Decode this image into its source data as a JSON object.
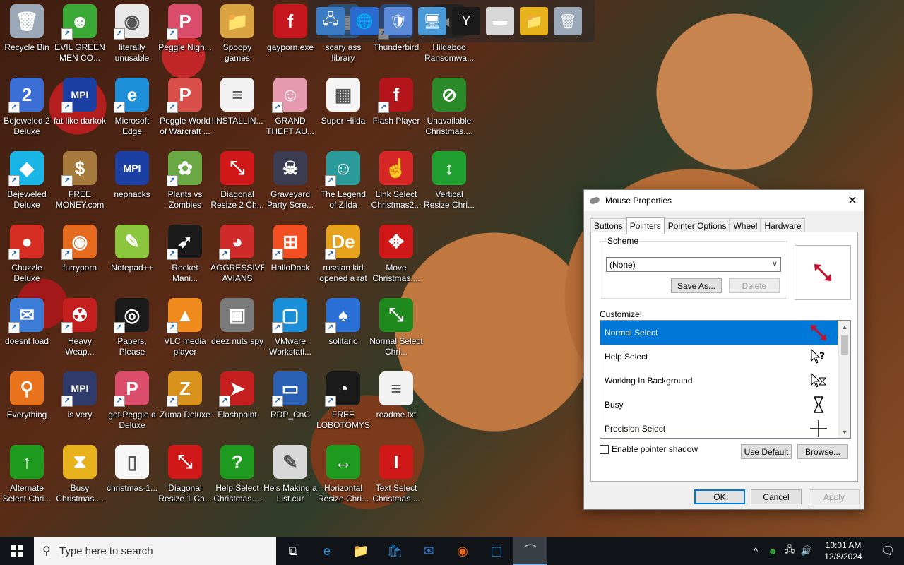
{
  "desktop": {
    "icons": [
      {
        "label": "Recycle Bin",
        "color": "#9aa8b8",
        "glyph": "🗑",
        "shortcut": false
      },
      {
        "label": "EVIL GREEN MEN CO...",
        "color": "#3aa935",
        "glyph": "☻",
        "shortcut": true
      },
      {
        "label": "literally unusable",
        "color": "#e8e8e8",
        "glyph": "◉",
        "shortcut": true
      },
      {
        "label": "Peggle Nigh...",
        "color": "#d94c6a",
        "glyph": "P",
        "shortcut": true
      },
      {
        "label": "Spoopy games",
        "color": "#d9a441",
        "glyph": "📁",
        "shortcut": false
      },
      {
        "label": "gayporn.exe",
        "color": "#c4161c",
        "glyph": "f",
        "shortcut": false
      },
      {
        "label": "scary ass library",
        "color": "#3b7bc4",
        "glyph": "▤",
        "shortcut": false
      },
      {
        "label": "Thunderbird",
        "color": "#2a6bd1",
        "glyph": "✉",
        "shortcut": true
      },
      {
        "label": "Hildaboo Ransomwa...",
        "color": "#1f1f1f",
        "glyph": "◐",
        "shortcut": false
      },
      {
        "label": "Bejeweled 2 Deluxe",
        "color": "#3b6fd6",
        "glyph": "2",
        "shortcut": true
      },
      {
        "label": "fat like darkok",
        "color": "#1b3fa3",
        "glyph": "MPI",
        "shortcut": true
      },
      {
        "label": "Microsoft Edge",
        "color": "#1c8fd8",
        "glyph": "e",
        "shortcut": true
      },
      {
        "label": "Peggle World of Warcraft ...",
        "color": "#d9504b",
        "glyph": "P",
        "shortcut": true
      },
      {
        "label": "!INSTALLIN...",
        "color": "#f2f2f2",
        "glyph": "≡",
        "shortcut": false
      },
      {
        "label": "GRAND THEFT AU...",
        "color": "#e59ab0",
        "glyph": "☺",
        "shortcut": true
      },
      {
        "label": "Super Hilda",
        "color": "#f5f5f5",
        "glyph": "▦",
        "shortcut": false
      },
      {
        "label": "Flash Player",
        "color": "#b3151b",
        "glyph": "f",
        "shortcut": true
      },
      {
        "label": "Unavailable Christmas....",
        "color": "#2a8a2a",
        "glyph": "⊘",
        "shortcut": false
      },
      {
        "label": "Bejeweled Deluxe",
        "color": "#1ab6e8",
        "glyph": "◆",
        "shortcut": true
      },
      {
        "label": "FREE MONEY.com",
        "color": "#a67a3c",
        "glyph": "$",
        "shortcut": true
      },
      {
        "label": "nephacks",
        "color": "#1b3fa3",
        "glyph": "MPI",
        "shortcut": false
      },
      {
        "label": "Plants vs Zombies",
        "color": "#6aa843",
        "glyph": "✿",
        "shortcut": true
      },
      {
        "label": "Diagonal Resize 2 Ch...",
        "color": "#d11818",
        "glyph": "⤡",
        "shortcut": false
      },
      {
        "label": "Graveyard Party Scre...",
        "color": "#3c3c52",
        "glyph": "☠",
        "shortcut": false
      },
      {
        "label": "The Legend of Zilda",
        "color": "#2a9a9a",
        "glyph": "☺",
        "shortcut": true
      },
      {
        "label": "Link Select Christmas2...",
        "color": "#d62626",
        "glyph": "☝",
        "shortcut": false
      },
      {
        "label": "Vertical Resize Chri...",
        "color": "#20a030",
        "glyph": "↕",
        "shortcut": false
      },
      {
        "label": "Chuzzle Deluxe",
        "color": "#d62e22",
        "glyph": "●",
        "shortcut": true
      },
      {
        "label": "furryporn",
        "color": "#e66b1f",
        "glyph": "◉",
        "shortcut": true
      },
      {
        "label": "Notepad++",
        "color": "#8cc63f",
        "glyph": "✎",
        "shortcut": false
      },
      {
        "label": "Rocket Mani...",
        "color": "#1a1a1a",
        "glyph": "➶",
        "shortcut": true
      },
      {
        "label": "AGGRESSIVE AVIANS",
        "color": "#d02b2b",
        "glyph": "◕",
        "shortcut": true
      },
      {
        "label": "HalloDock",
        "color": "#f25022",
        "glyph": "⊞",
        "shortcut": true
      },
      {
        "label": "russian kid opened a rat",
        "color": "#e8a21c",
        "glyph": "De",
        "shortcut": true
      },
      {
        "label": "Move Christmas....",
        "color": "#d11818",
        "glyph": "✥",
        "shortcut": false
      },
      {
        "label": "doesnt load",
        "color": "#3c7cd6",
        "glyph": "✉",
        "shortcut": true
      },
      {
        "label": "Heavy Weap...",
        "color": "#c41e1e",
        "glyph": "☢",
        "shortcut": true
      },
      {
        "label": "Papers, Please",
        "color": "#1a1a1a",
        "glyph": "◎",
        "shortcut": true
      },
      {
        "label": "VLC media player",
        "color": "#f08a1c",
        "glyph": "▲",
        "shortcut": true
      },
      {
        "label": "deez nuts spy",
        "color": "#7a7a7a",
        "glyph": "▣",
        "shortcut": false
      },
      {
        "label": "VMware Workstati...",
        "color": "#1a8fd8",
        "glyph": "▢",
        "shortcut": true
      },
      {
        "label": "solitario",
        "color": "#2a6fd6",
        "glyph": "♠",
        "shortcut": true
      },
      {
        "label": "Normal Select Chri...",
        "color": "#1e8a1e",
        "glyph": "⤡",
        "shortcut": false
      },
      {
        "label": "Everything",
        "color": "#e8731c",
        "glyph": "⚲",
        "shortcut": false
      },
      {
        "label": "is very",
        "color": "#2f3b6b",
        "glyph": "MPI",
        "shortcut": true
      },
      {
        "label": "get Peggle d Deluxe",
        "color": "#d94c6a",
        "glyph": "P",
        "shortcut": true
      },
      {
        "label": "Zuma Deluxe",
        "color": "#d9931c",
        "glyph": "Z",
        "shortcut": true
      },
      {
        "label": "Flashpoint",
        "color": "#c41e1e",
        "glyph": "➤",
        "shortcut": true
      },
      {
        "label": "RDP_CnC",
        "color": "#2a5fb4",
        "glyph": "▭",
        "shortcut": true
      },
      {
        "label": "FREE LOBOTOMYS",
        "color": "#1a1a1a",
        "glyph": "◔",
        "shortcut": true
      },
      {
        "label": "readme.txt",
        "color": "#f2f2f2",
        "glyph": "≡",
        "shortcut": false
      },
      {
        "label": "Alternate Select Chri...",
        "color": "#1e9a1e",
        "glyph": "↑",
        "shortcut": false
      },
      {
        "label": "Busy Christmas....",
        "color": "#e8b21c",
        "glyph": "⧗",
        "shortcut": false
      },
      {
        "label": "christmas-1...",
        "color": "#f7f7f7",
        "glyph": "▯",
        "shortcut": false
      },
      {
        "label": "Diagonal Resize 1 Ch...",
        "color": "#d11818",
        "glyph": "⤡",
        "shortcut": false
      },
      {
        "label": "Help Select Christmas....",
        "color": "#1e9a1e",
        "glyph": "?",
        "shortcut": false
      },
      {
        "label": "He's Making a List.cur",
        "color": "#d8d8d8",
        "glyph": "✎",
        "shortcut": false
      },
      {
        "label": "Horizontal Resize Chri...",
        "color": "#1e9a1e",
        "glyph": "↔",
        "shortcut": false
      },
      {
        "label": "Text Select Christmas....",
        "color": "#d11818",
        "glyph": "I",
        "shortcut": false
      }
    ]
  },
  "top_strip": {
    "items": [
      {
        "name": "network-icon",
        "glyph": "🖧",
        "color": "#3b7bc4"
      },
      {
        "name": "globe-icon",
        "glyph": "🌐",
        "color": "#2a6bd1"
      },
      {
        "name": "shield-icon",
        "glyph": "🛡",
        "color": "#5a8ad8"
      },
      {
        "name": "monitor-icon",
        "glyph": "🖥",
        "color": "#4a9ad8"
      },
      {
        "name": "yashma-icon",
        "glyph": "Y",
        "color": "#1a1a1a"
      },
      {
        "name": "drive-icon",
        "glyph": "▬",
        "color": "#d8d8d8"
      },
      {
        "name": "folder-icon",
        "glyph": "📁",
        "color": "#e8b21c"
      },
      {
        "name": "recycle-icon",
        "glyph": "🗑",
        "color": "#9aa8b8"
      }
    ]
  },
  "dialog": {
    "title": "Mouse Properties",
    "close": "✕",
    "tabs": [
      "Buttons",
      "Pointers",
      "Pointer Options",
      "Wheel",
      "Hardware"
    ],
    "active_tab": "Pointers",
    "scheme": {
      "group_title": "Scheme",
      "value": "(None)",
      "save_as": "Save As...",
      "delete": "Delete"
    },
    "customize_label": "Customize:",
    "pointers": [
      {
        "label": "Normal Select",
        "cursor": "diag-red",
        "selected": true
      },
      {
        "label": "Help Select",
        "cursor": "help",
        "selected": false
      },
      {
        "label": "Working In Background",
        "cursor": "working",
        "selected": false
      },
      {
        "label": "Busy",
        "cursor": "busy",
        "selected": false
      },
      {
        "label": "Precision Select",
        "cursor": "cross",
        "selected": false
      }
    ],
    "shadow_label": "Enable pointer shadow",
    "use_default": "Use Default",
    "browse": "Browse...",
    "ok": "OK",
    "cancel": "Cancel",
    "apply": "Apply",
    "accent": "#0078d7"
  },
  "taskbar": {
    "search_placeholder": "Type here to search",
    "apps": [
      {
        "name": "task-view-icon",
        "glyph": "⧉"
      },
      {
        "name": "edge-icon",
        "glyph": "e"
      },
      {
        "name": "file-explorer-icon",
        "glyph": "📁"
      },
      {
        "name": "store-icon",
        "glyph": "🛍"
      },
      {
        "name": "mail-icon",
        "glyph": "✉"
      },
      {
        "name": "firefox-icon",
        "glyph": "◉"
      },
      {
        "name": "vmware-icon",
        "glyph": "▢"
      },
      {
        "name": "mouse-properties-icon",
        "glyph": "⌒"
      }
    ],
    "tray": {
      "chevron": "^",
      "people": "☻",
      "network": "🖧",
      "volume": "🔊",
      "time": "10:01 AM",
      "date": "12/8/2024",
      "notifications": "🗨"
    }
  }
}
